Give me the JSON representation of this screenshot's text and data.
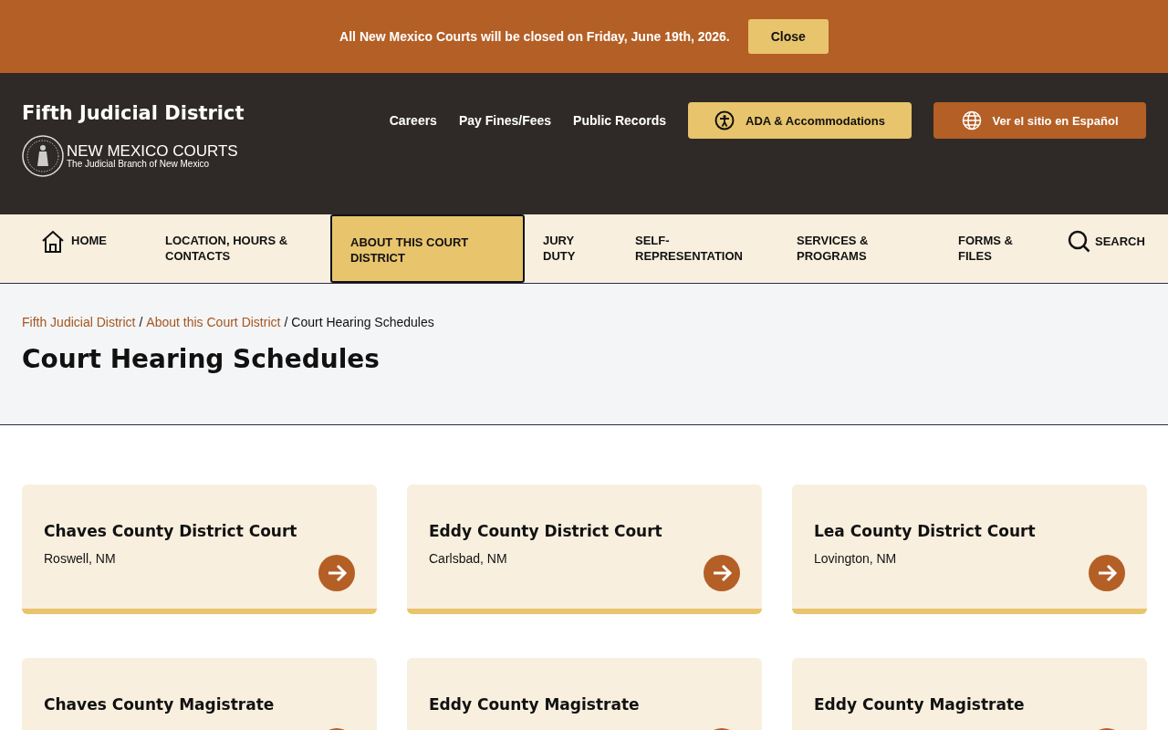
{
  "alert": {
    "message": "All New Mexico Courts will be closed on Friday, June 19th, 2026.",
    "button": "Close"
  },
  "header": {
    "site_title": "Fifth Judicial District",
    "logo_title": "NEW MEXICO COURTS",
    "logo_subtitle": "The Judicial Branch of New Mexico",
    "links": [
      "Careers",
      "Pay Fines/Fees",
      "Public Records"
    ],
    "ada_button": "ADA & Accommodations",
    "language_button": "Ver el sitio en Español"
  },
  "nav": [
    {
      "label": "HOME",
      "kind": "home",
      "selected": false
    },
    {
      "label": "LOCATION, HOURS & CONTACTS",
      "kind": "link",
      "selected": false
    },
    {
      "label": "ABOUT THIS COURT DISTRICT",
      "kind": "link",
      "selected": true
    },
    {
      "label": "JURY DUTY",
      "kind": "link",
      "selected": false
    },
    {
      "label": "SELF-REPRESENTATION",
      "kind": "link",
      "selected": false
    },
    {
      "label": "SERVICES & PROGRAMS",
      "kind": "link",
      "selected": false
    },
    {
      "label": "FORMS & FILES",
      "kind": "link",
      "selected": false
    },
    {
      "label": "SEARCH",
      "kind": "search",
      "selected": false
    }
  ],
  "breadcrumb_separator": "/",
  "breadcrumb": [
    "Fifth Judicial District",
    "About this Court District",
    "Court Hearing Schedules"
  ],
  "page_title": "Court Hearing Schedules",
  "cards": [
    {
      "title": "Chaves County District Court",
      "location": "Roswell, NM"
    },
    {
      "title": "Eddy County District Court",
      "location": "Carlsbad, NM"
    },
    {
      "title": "Lea County District Court",
      "location": "Lovington, NM"
    },
    {
      "title": "Chaves County Magistrate"
    },
    {
      "title": "Eddy County Magistrate"
    },
    {
      "title": "Eddy County Magistrate"
    }
  ]
}
